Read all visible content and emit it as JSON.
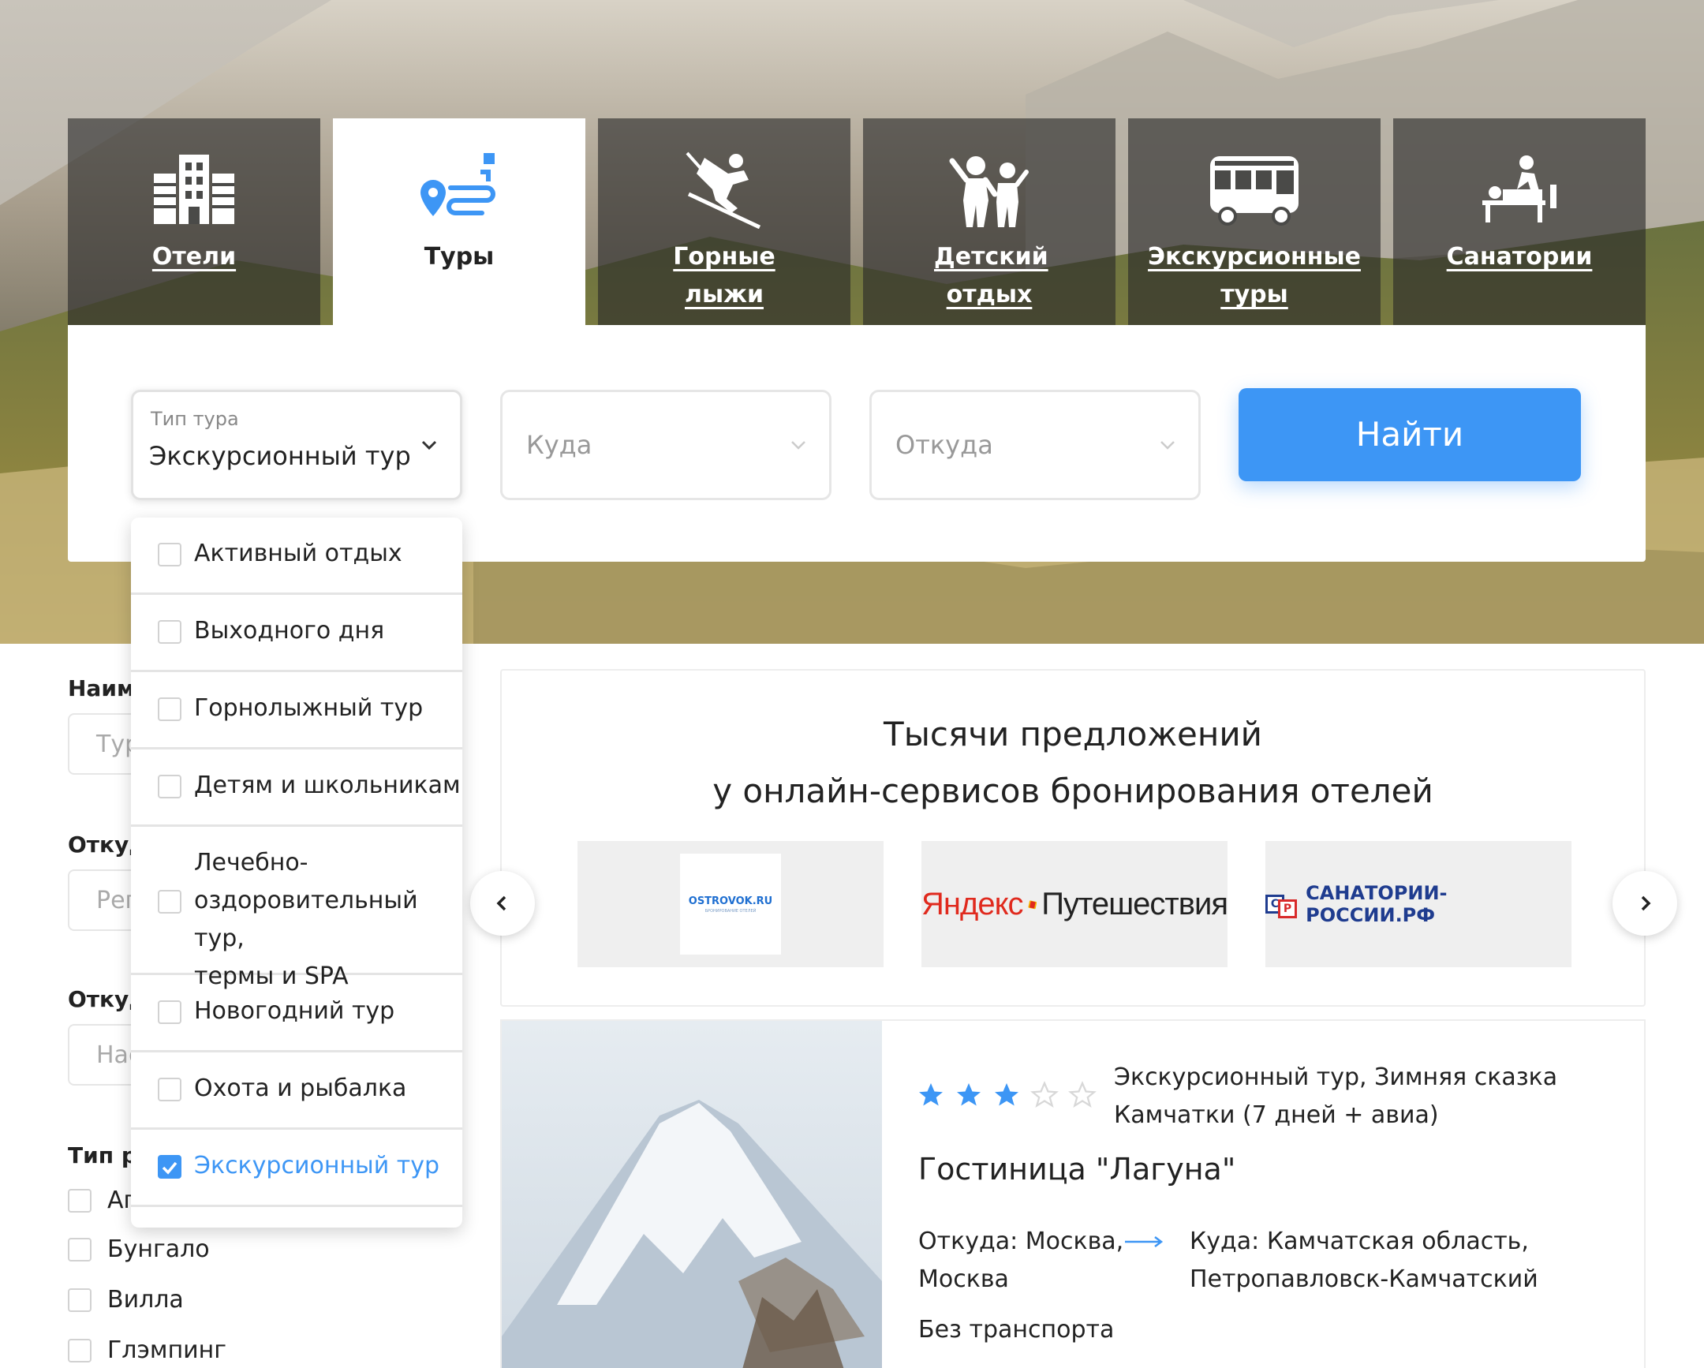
{
  "tabs": [
    {
      "label": "Отели",
      "icon": "hotel-building-icon",
      "active": false
    },
    {
      "label": "Туры",
      "icon": "route-pin-icon",
      "active": true
    },
    {
      "label": "Горные лыжи",
      "icon": "skier-icon",
      "active": false
    },
    {
      "label": "Детский отдых",
      "icon": "children-icon",
      "active": false
    },
    {
      "label": "Экскурсионные туры",
      "icon": "bus-icon",
      "active": false
    },
    {
      "label": "Санатории",
      "icon": "massage-icon",
      "active": false
    }
  ],
  "search": {
    "tour_type_label": "Тип тура",
    "tour_type_value": "Экскурсионный тур,",
    "to_placeholder": "Куда",
    "from_placeholder": "Откуда",
    "find_button": "Найти"
  },
  "dropdown": {
    "items": [
      {
        "label": "Активный отдых",
        "checked": false
      },
      {
        "label": "Выходного дня",
        "checked": false
      },
      {
        "label": "Горнолыжный тур",
        "checked": false
      },
      {
        "label": "Детям и школьникам",
        "checked": false
      },
      {
        "label": "Лечебно-\nоздоровительный тур,\nтермы и SPA",
        "checked": false
      },
      {
        "label": "Новогодний тур",
        "checked": false
      },
      {
        "label": "Охота и рыбалка",
        "checked": false
      },
      {
        "label": "Экскурсионный тур",
        "checked": true
      }
    ]
  },
  "filters": {
    "name_title": "Наиме",
    "name_placeholder": "Тур",
    "from_title_1": "Откуд",
    "from_placeholder_1": "Реги",
    "from_title_2": "Откуд",
    "from_placeholder_2": "Нас",
    "placement_title": "Тип ра",
    "placement_options": [
      {
        "label": "Ап",
        "checked": false
      },
      {
        "label": "Бунгало",
        "checked": false
      },
      {
        "label": "Вилла",
        "checked": false
      },
      {
        "label": "Глэмпинг",
        "checked": false
      }
    ]
  },
  "partners": {
    "heading_line1": "Тысячи предложений",
    "heading_line2": "у онлайн-сервисов бронирования отелей",
    "logos": [
      {
        "name": "OSTROVOK.RU",
        "sub": "БРОНИРОВАНИЕ ОТЕЛЕЙ"
      },
      {
        "name": "Яндекс Путешествия",
        "part1": "Яндекс",
        "part2": "Путешествия"
      },
      {
        "name": "САНАТОРИИ-РОССИИ.РФ",
        "badge1": "С",
        "badge2": "Р"
      }
    ]
  },
  "hotel": {
    "rating": 3,
    "rating_max": 5,
    "tour_line1": "Экскурсионный тур, Зимняя сказка",
    "tour_line2": "Камчатки (7 дней + авиа)",
    "name": "Гостиница \"Лагуна\"",
    "from_line1": "Откуда: Москва,",
    "from_line2": "Москва",
    "to_line1": "Куда: Камчатская область,",
    "to_line2": "Петропавловск-Камчатский",
    "transport": "Без транспорта"
  },
  "colors": {
    "accent": "#3d96f5",
    "star_filled": "#3d96f5",
    "star_empty": "#e0e0e0"
  }
}
